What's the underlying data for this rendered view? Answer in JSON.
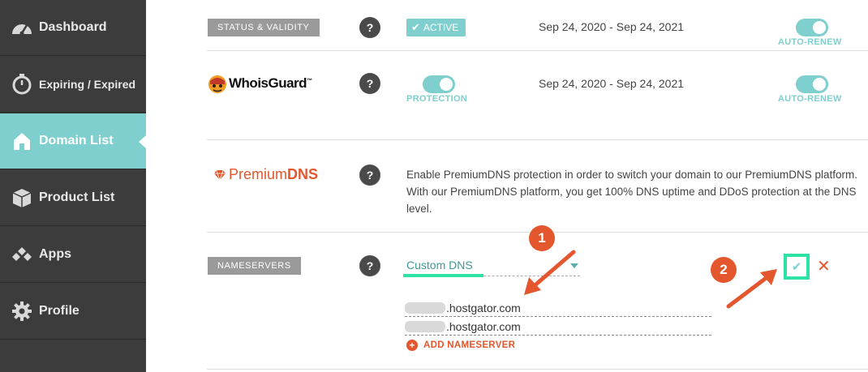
{
  "sidebar": {
    "items": [
      {
        "label": "Dashboard",
        "icon": "speedometer-icon"
      },
      {
        "label": "Expiring / Expired",
        "icon": "timer-icon"
      },
      {
        "label": "Domain List",
        "icon": "home-icon",
        "active": true
      },
      {
        "label": "Product List",
        "icon": "box-icon"
      },
      {
        "label": "Apps",
        "icon": "apps-icon"
      },
      {
        "label": "Profile",
        "icon": "gear-icon"
      }
    ]
  },
  "status": {
    "tag": "STATUS & VALIDITY",
    "help": "?",
    "badge": "ACTIVE",
    "dates": "Sep 24, 2020 - Sep 24, 2021",
    "autorenew_label": "AUTO-RENEW"
  },
  "whoisguard": {
    "logo_text": "WhoisGuard",
    "logo_tm": "™",
    "help": "?",
    "protection_label": "PROTECTION",
    "dates": "Sep 24, 2020 - Sep 24, 2021",
    "autorenew_label": "AUTO-RENEW"
  },
  "premiumdns": {
    "logo_light": "Premium",
    "logo_bold": "DNS",
    "help": "?",
    "description": "Enable PremiumDNS protection in order to switch your domain to our PremiumDNS platform. With our PremiumDNS platform, you get 100% DNS uptime and DDoS protection at the DNS level."
  },
  "nameservers": {
    "tag": "NAMESERVERS",
    "help": "?",
    "selected": "Custom DNS",
    "entries": [
      ".hostgator.com",
      ".hostgator.com"
    ],
    "add_label": "ADD NAMESERVER",
    "add_icon": "plus-circle-icon",
    "confirm_icon": "check-icon",
    "cancel_icon": "close-icon"
  },
  "annotations": {
    "step1": "1",
    "step2": "2"
  },
  "colors": {
    "sidebar_bg": "#3c3c3c",
    "accent_teal": "#7ecfcd",
    "highlight_green": "#2de3a4",
    "alert_orange": "#e4572e",
    "tag_gray": "#9a9a9a"
  }
}
